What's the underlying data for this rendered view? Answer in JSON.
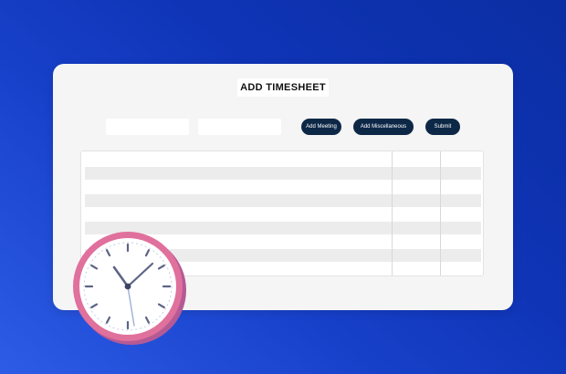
{
  "form": {
    "title": "ADD TIMESHEET",
    "fields": [
      {
        "value": "",
        "placeholder": ""
      },
      {
        "value": "",
        "placeholder": ""
      }
    ],
    "buttons": {
      "add_meeting": "Add Meeting",
      "add_miscellaneous": "Add Miscellaneous",
      "submit": "Submit"
    }
  },
  "table": {
    "columns": 3,
    "rows": 5
  },
  "clock": {
    "icon": "wall-clock-icon",
    "time_shown": "10:09"
  },
  "colors": {
    "background_gradient_start": "#2d5ce6",
    "background_gradient_end": "#0b2ea3",
    "card": "#f5f5f5",
    "button": "#0d2847",
    "clock_rim": "#e0709c"
  }
}
